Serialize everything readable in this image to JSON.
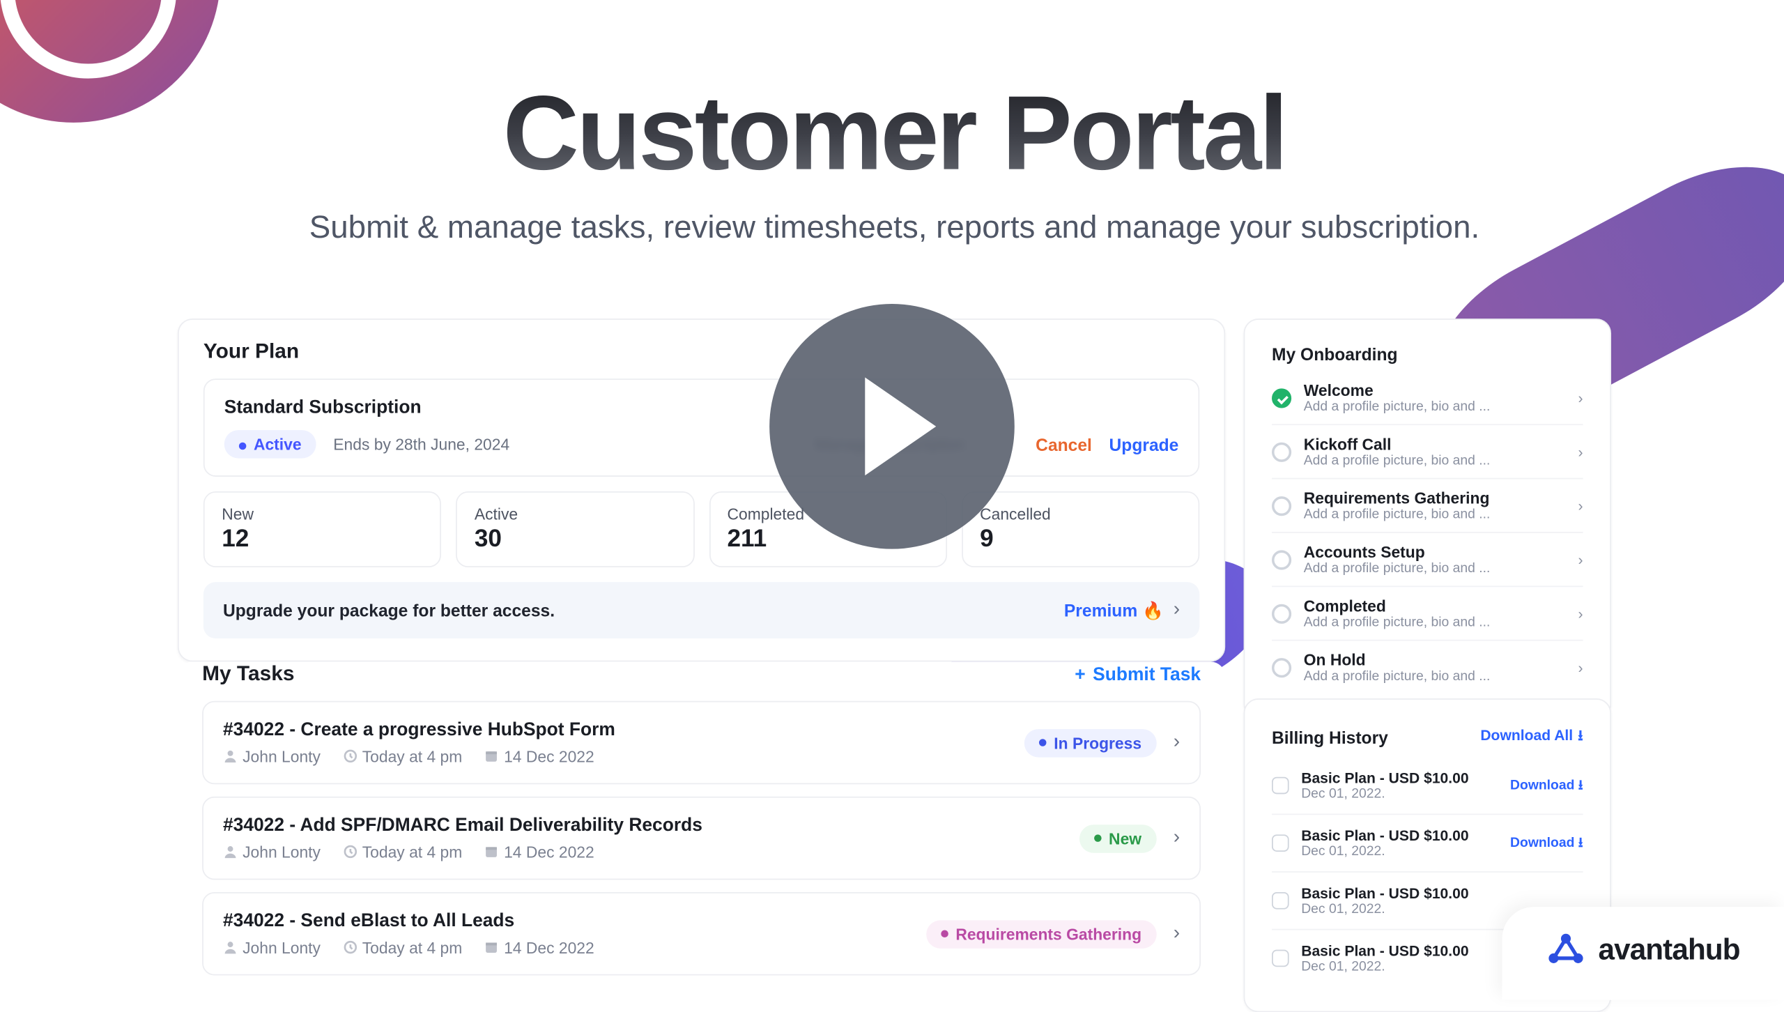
{
  "hero": {
    "title": "Customer Portal",
    "subtitle": "Submit & manage tasks, review timesheets, reports and manage your subscription."
  },
  "plan": {
    "section_title": "Your Plan",
    "name": "Standard Subscription",
    "status_label": "Active",
    "ends_label": "Ends by 28th June, 2024",
    "manage_label": "Manage Subscription",
    "cancel_label": "Cancel",
    "upgrade_label": "Upgrade",
    "stats": [
      {
        "label": "New",
        "value": "12"
      },
      {
        "label": "Active",
        "value": "30"
      },
      {
        "label": "Completed",
        "value": "211"
      },
      {
        "label": "Cancelled",
        "value": "9"
      }
    ],
    "banner_text": "Upgrade your package for better access.",
    "banner_cta": "Premium 🔥"
  },
  "tasks": {
    "section_title": "My Tasks",
    "submit_label": "Submit Task",
    "items": [
      {
        "title": "#34022 - Create a progressive HubSpot Form",
        "assignee": "John Lonty",
        "time": "Today at 4 pm",
        "date": "14 Dec 2022",
        "status_label": "In Progress",
        "status_kind": "inprog"
      },
      {
        "title": "#34022 - Add SPF/DMARC Email Deliverability Records",
        "assignee": "John Lonty",
        "time": "Today at 4 pm",
        "date": "14 Dec 2022",
        "status_label": "New",
        "status_kind": "new"
      },
      {
        "title": "#34022 - Send eBlast to All Leads",
        "assignee": "John Lonty",
        "time": "Today at 4 pm",
        "date": "14 Dec 2022",
        "status_label": "Requirements Gathering",
        "status_kind": "req"
      }
    ]
  },
  "onboarding": {
    "section_title": "My Onboarding",
    "item_sub": "Add a profile picture, bio and ...",
    "items": [
      {
        "title": "Welcome",
        "done": true
      },
      {
        "title": "Kickoff Call",
        "done": false
      },
      {
        "title": "Requirements Gathering",
        "done": false
      },
      {
        "title": "Accounts Setup",
        "done": false
      },
      {
        "title": "Completed",
        "done": false
      },
      {
        "title": "On Hold",
        "done": false
      }
    ]
  },
  "billing": {
    "section_title": "Billing History",
    "download_all": "Download All",
    "download": "Download",
    "items": [
      {
        "name": "Basic Plan - USD $10.00",
        "date": "Dec 01, 2022.",
        "show_dl": true
      },
      {
        "name": "Basic Plan - USD $10.00",
        "date": "Dec 01, 2022.",
        "show_dl": true
      },
      {
        "name": "Basic Plan - USD $10.00",
        "date": "Dec 01, 2022.",
        "show_dl": false
      },
      {
        "name": "Basic Plan - USD $10.00",
        "date": "Dec 01, 2022.",
        "show_dl": false
      }
    ]
  },
  "brand": {
    "name": "avantahub"
  }
}
